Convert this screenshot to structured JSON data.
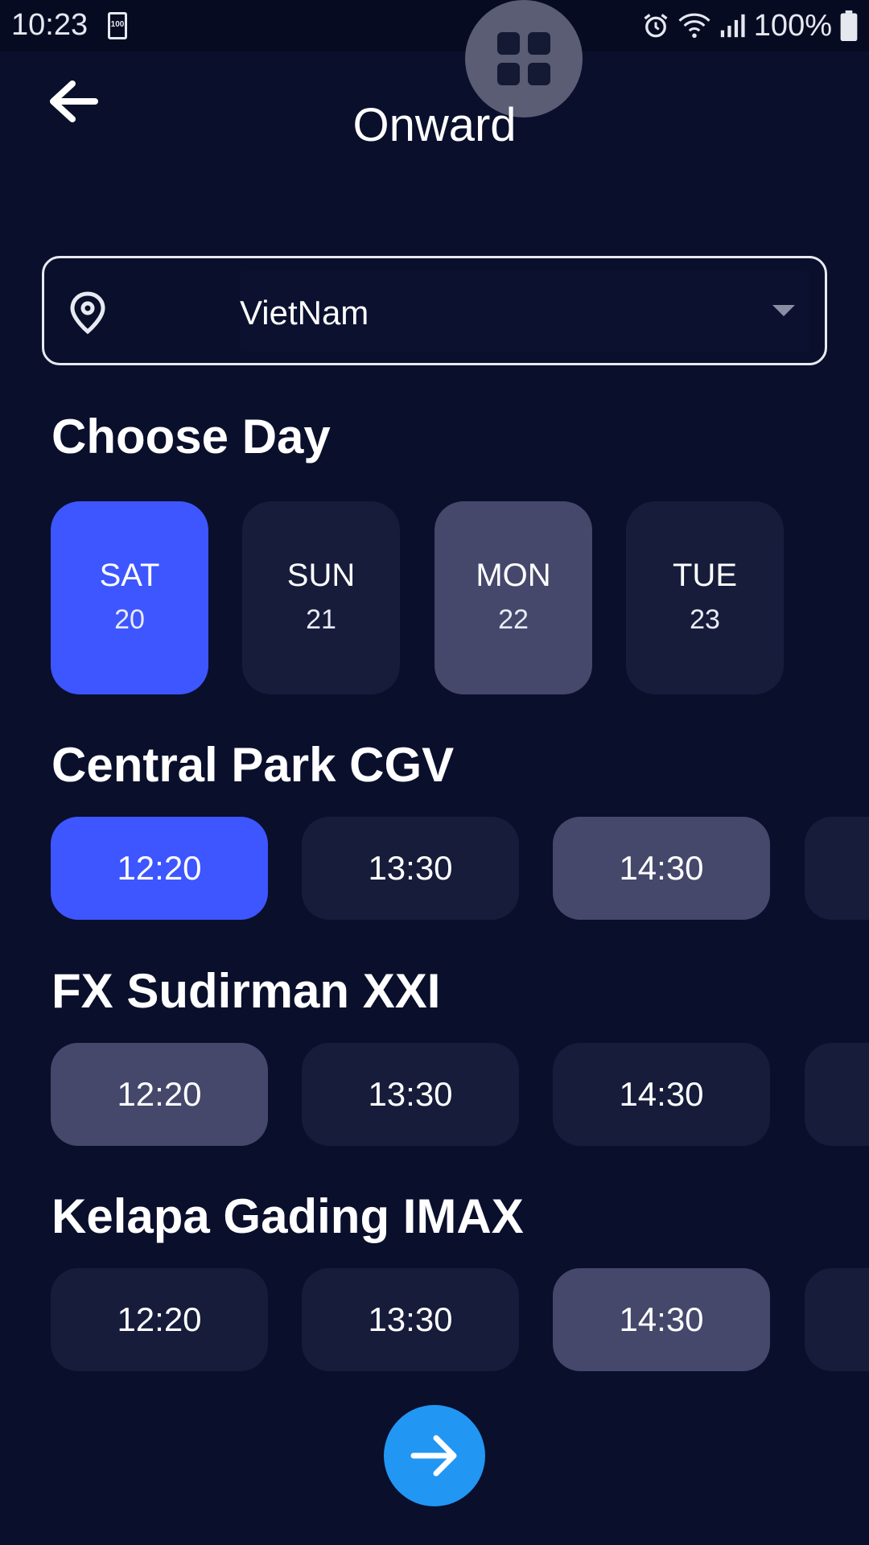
{
  "status_bar": {
    "time": "10:23",
    "battery_saver_label": "100",
    "battery_percent": "100%"
  },
  "header": {
    "title": "Onward"
  },
  "location": {
    "value": "VietNam"
  },
  "choose_day": {
    "title": "Choose Day",
    "days": [
      {
        "name": "SAT",
        "date": "20"
      },
      {
        "name": "SUN",
        "date": "21"
      },
      {
        "name": "MON",
        "date": "22"
      },
      {
        "name": "TUE",
        "date": "23"
      }
    ]
  },
  "cinemas": [
    {
      "name": "Central Park CGV",
      "times": [
        "12:20",
        "13:30",
        "14:30"
      ]
    },
    {
      "name": "FX Sudirman XXI",
      "times": [
        "12:20",
        "13:30",
        "14:30"
      ]
    },
    {
      "name": "Kelapa Gading IMAX",
      "times": [
        "12:20",
        "13:30",
        "14:30"
      ]
    }
  ],
  "colors": {
    "background": "#0a0f2c",
    "selected": "#3d56ff",
    "highlight": "#45486b",
    "chip": "#161c3a",
    "next_button": "#2196f3"
  },
  "icons": {
    "back": "arrow-left-icon",
    "location": "map-pin-icon",
    "dropdown": "caret-down-icon",
    "next": "arrow-right-icon",
    "floating": "grid-icon"
  }
}
